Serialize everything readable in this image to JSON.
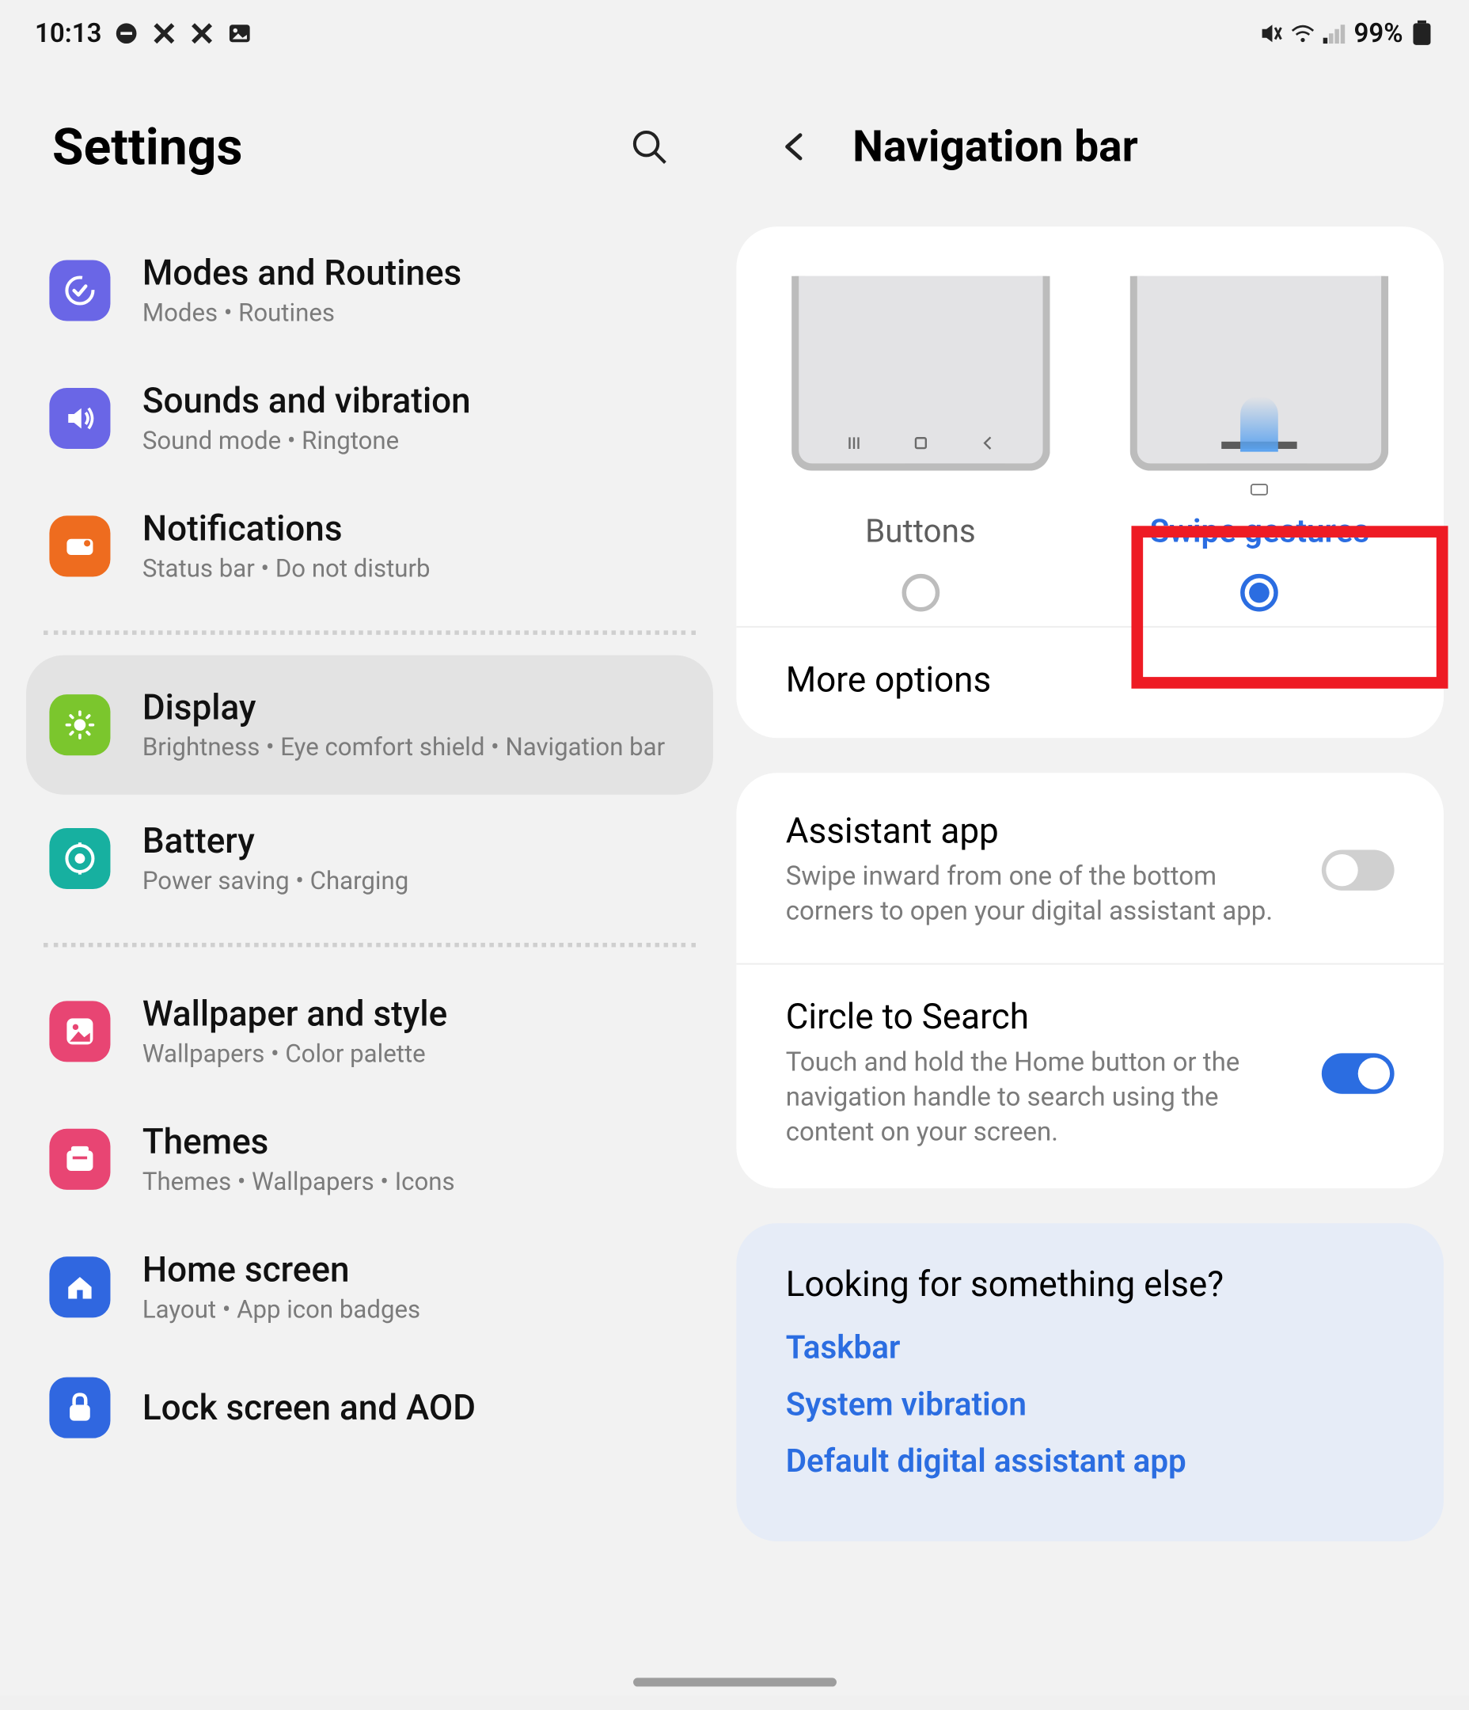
{
  "status": {
    "time": "10:13",
    "battery": "99%"
  },
  "left": {
    "title": "Settings",
    "items": [
      {
        "icon": "modes",
        "color": "#6a66e6",
        "title": "Modes and Routines",
        "sub": "Modes  •  Routines"
      },
      {
        "icon": "sound",
        "color": "#6a66e6",
        "title": "Sounds and vibration",
        "sub": "Sound mode  •  Ringtone"
      },
      {
        "icon": "notif",
        "color": "#ee6c1f",
        "title": "Notifications",
        "sub": "Status bar  •  Do not disturb"
      },
      {
        "divider": true
      },
      {
        "icon": "display",
        "color": "#7bc62d",
        "title": "Display",
        "sub": "Brightness  •  Eye comfort shield  •  Navigation bar",
        "selected": true
      },
      {
        "icon": "battery",
        "color": "#17b0a0",
        "title": "Battery",
        "sub": "Power saving  •  Charging"
      },
      {
        "divider": true
      },
      {
        "icon": "wallpaper",
        "color": "#e84573",
        "title": "Wallpaper and style",
        "sub": "Wallpapers  •  Color palette"
      },
      {
        "icon": "themes",
        "color": "#e84573",
        "title": "Themes",
        "sub": "Themes  •  Wallpapers  •  Icons"
      },
      {
        "icon": "home",
        "color": "#3067e0",
        "title": "Home screen",
        "sub": "Layout  •  App icon badges"
      },
      {
        "icon": "lock",
        "color": "#3067e0",
        "title": "Lock screen and AOD",
        "sub": ""
      }
    ]
  },
  "right": {
    "title": "Navigation bar",
    "nav_types": {
      "buttons": "Buttons",
      "gestures": "Swipe gestures",
      "selected": "gestures"
    },
    "more": "More options",
    "toggles": [
      {
        "title": "Assistant app",
        "sub": "Swipe inward from one of the bottom corners to open your digital assistant app.",
        "on": false
      },
      {
        "title": "Circle to Search",
        "sub": "Touch and hold the Home button or the navigation handle to search using the content on your screen.",
        "on": true
      }
    ],
    "looking": {
      "title": "Looking for something else?",
      "links": [
        "Taskbar",
        "System vibration",
        "Default digital assistant app"
      ]
    }
  }
}
